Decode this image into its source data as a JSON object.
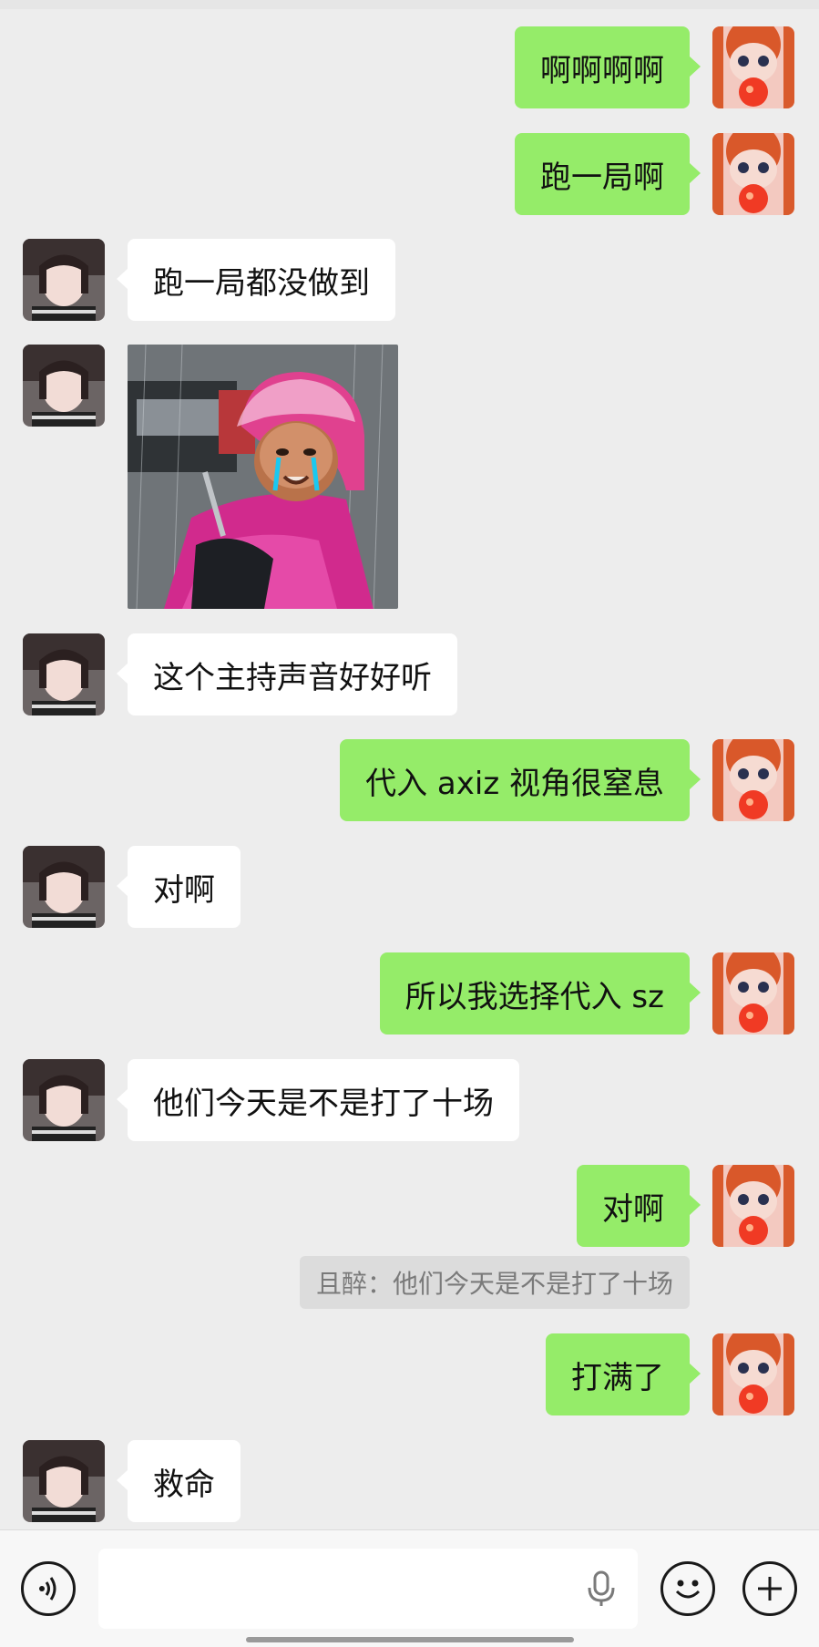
{
  "contact": {
    "name": "且醉"
  },
  "messages": [
    {
      "from": "me",
      "type": "text",
      "text": "啊啊啊啊"
    },
    {
      "from": "me",
      "type": "text",
      "text": "跑一局啊"
    },
    {
      "from": "other",
      "type": "text",
      "text": "跑一局都没做到"
    },
    {
      "from": "other",
      "type": "sticker",
      "icon": "crying-baby-helmet-sticker"
    },
    {
      "from": "other",
      "type": "text",
      "text": "这个主持声音好好听"
    },
    {
      "from": "me",
      "type": "text",
      "text": "代入 axiz 视角很窒息"
    },
    {
      "from": "other",
      "type": "text",
      "text": "对啊"
    },
    {
      "from": "me",
      "type": "text",
      "text": "所以我选择代入 sz"
    },
    {
      "from": "other",
      "type": "text",
      "text": "他们今天是不是打了十场"
    },
    {
      "from": "me",
      "type": "text",
      "text": "对啊"
    },
    {
      "from": "me",
      "type": "text",
      "text": "打满了"
    },
    {
      "from": "other",
      "type": "text",
      "text": "救命"
    }
  ],
  "quote": {
    "author": "且醉",
    "text": "且醉：他们今天是不是打了十场"
  },
  "input_bar": {
    "value": "",
    "icons": [
      "voice-icon",
      "microphone-icon",
      "emoji-icon",
      "plus-icon"
    ]
  },
  "colors": {
    "background": "#ededed",
    "my_bubble": "#95ec69",
    "other_bubble": "#ffffff",
    "quote_bg": "#dcdcdc"
  }
}
